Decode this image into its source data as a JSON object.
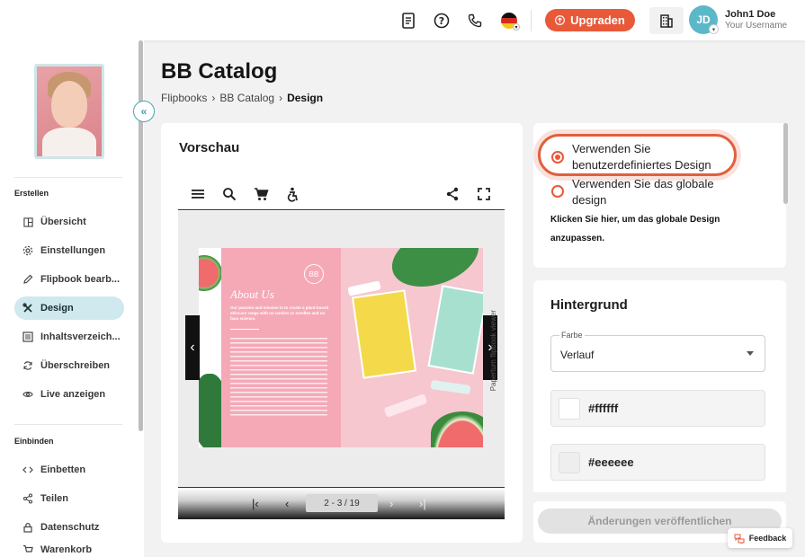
{
  "topbar": {
    "icons": [
      "document-icon",
      "help-icon",
      "phone-icon",
      "german-flag-icon"
    ],
    "upgrade_label": "Upgraden",
    "user": {
      "initials": "JD",
      "name": "John1 Doe",
      "username": "Your Username"
    }
  },
  "sidebar": {
    "sections": [
      {
        "title": "Erstellen",
        "items": [
          {
            "label": "Übersicht",
            "icon": "overview-icon"
          },
          {
            "label": "Einstellungen",
            "icon": "gear-icon"
          },
          {
            "label": "Flipbook bearb...",
            "icon": "pencil-icon"
          },
          {
            "label": "Design",
            "icon": "design-tools-icon",
            "active": true
          },
          {
            "label": "Inhaltsverzeich...",
            "icon": "list-icon"
          },
          {
            "label": "Überschreiben",
            "icon": "refresh-icon"
          },
          {
            "label": "Live anzeigen",
            "icon": "eye-icon"
          }
        ]
      },
      {
        "title": "Einbinden",
        "items": [
          {
            "label": "Einbetten",
            "icon": "code-icon"
          },
          {
            "label": "Teilen",
            "icon": "share-icon"
          },
          {
            "label": "Datenschutz",
            "icon": "lock-icon"
          },
          {
            "label": "Warenkorb",
            "icon": "cart-icon"
          }
        ]
      }
    ]
  },
  "header": {
    "title": "BB Catalog",
    "breadcrumb": [
      "Flipbooks",
      "BB Catalog",
      "Design"
    ]
  },
  "preview": {
    "title": "Vorschau",
    "watermark": "Paperturn flipbook viewer",
    "page_indicator": "2 - 3 / 19",
    "page_left": {
      "heading": "About Us",
      "tagline": "Our passion and mission is to create a plant-based skincare range with no nasties or needles and no faux science."
    }
  },
  "design": {
    "option_custom": "Verwenden Sie benutzerdefiniertes Design",
    "option_global": "Verwenden Sie das globale design",
    "hint": "Klicken Sie hier, um das globale Design anzupassen."
  },
  "background": {
    "title": "Hintergrund",
    "select_label": "Farbe",
    "select_value": "Verlauf",
    "colors": [
      {
        "hex": "#ffffff",
        "label": "#ffffff"
      },
      {
        "hex": "#eeeeee",
        "label": "#eeeeee"
      }
    ]
  },
  "publish_label": "Änderungen veröffentlichen",
  "feedback_label": "Feedback",
  "colors": {
    "accent": "#e8593a",
    "active_nav": "#cfe9ee",
    "avatar": "#5ab8c9"
  }
}
